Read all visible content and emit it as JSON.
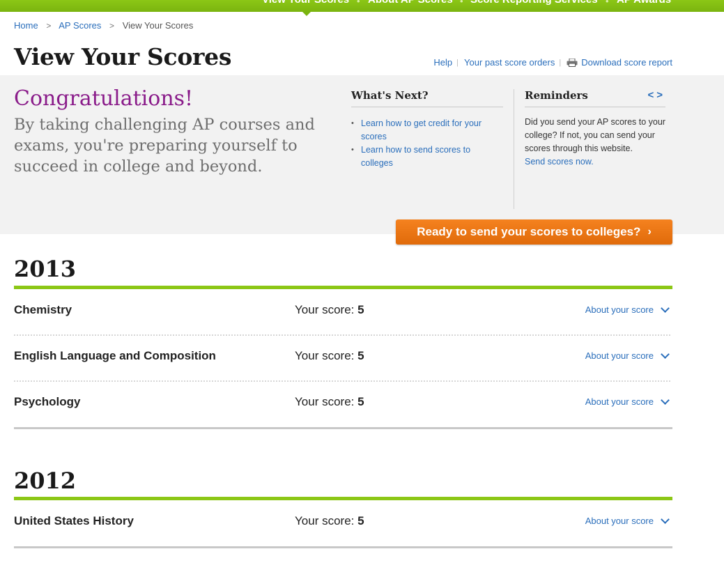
{
  "topnav": {
    "items": [
      "View Your Scores",
      "About AP Scores",
      "Score Reporting Services",
      "AP Awards"
    ]
  },
  "breadcrumb": {
    "items": [
      "Home",
      "AP Scores",
      "View Your Scores"
    ],
    "separator": ">"
  },
  "page": {
    "title": "View Your Scores"
  },
  "util_links": {
    "help": "Help",
    "past_orders": "Your past score orders",
    "download": "Download score report",
    "pipe": "|"
  },
  "hero": {
    "heading": "Congratulations!",
    "text": "By taking challenging AP courses and exams, you're preparing yourself to succeed in college and beyond."
  },
  "whats_next": {
    "title": "What's Next?",
    "links": [
      "Learn how to get credit for your scores",
      "Learn how to send scores to colleges"
    ]
  },
  "reminders": {
    "title": "Reminders",
    "prev": "<",
    "next": ">",
    "text": "Did you send your AP scores to your college? If not, you can send your scores through this website.",
    "link": "Send scores now."
  },
  "cta": {
    "label": "Ready to send your scores to colleges?",
    "chevron": "›"
  },
  "score_label": "Your score:",
  "about_label": "About your score",
  "years": [
    {
      "year": "2013",
      "subjects": [
        {
          "name": "Chemistry",
          "score": "5"
        },
        {
          "name": "English Language and Composition",
          "score": "5"
        },
        {
          "name": "Psychology",
          "score": "5"
        }
      ]
    },
    {
      "year": "2012",
      "subjects": [
        {
          "name": "United States History",
          "score": "5"
        }
      ]
    }
  ],
  "colors": {
    "accent_green": "#8cc716",
    "cta_orange": "#f5821f",
    "link_blue": "#2a6ebb",
    "congrats_purple": "#8a1c8a"
  }
}
